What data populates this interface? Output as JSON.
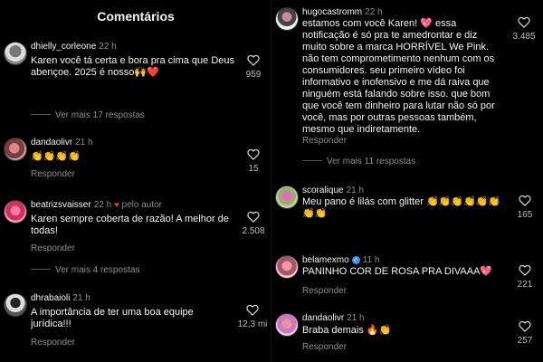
{
  "header": {
    "title": "Comentários"
  },
  "left": {
    "comments": [
      {
        "user": "dhielly_corleone",
        "time": "22 h",
        "text": "Karen você tá certa e bora pra cima que Deus abençoe.  2025 é nosso🙌❤️",
        "reply_label": "",
        "likes": "959",
        "more_replies": "Ver mais 17 respostas"
      },
      {
        "user": "dandaolivr",
        "time": "21 h",
        "text": "👏👏👏👏",
        "reply_label": "Responder",
        "likes": "15"
      },
      {
        "user": "beatrizsvaisser",
        "time": "22 h",
        "by_author": "pelo autor",
        "text": "Karen sempre coberta de razão! A melhor de todas!",
        "reply_label": "Responder",
        "likes": "2.508",
        "more_replies": "Ver mais 4 respostas"
      },
      {
        "user": "dhrabaioli",
        "time": "21 h",
        "text": "A importância de ter uma boa equipe jurídica!!!",
        "reply_label": "Responder",
        "likes": "12,3 mi"
      }
    ]
  },
  "right": {
    "comments": [
      {
        "user": "hugocastromm",
        "time": "22 h",
        "text": "estamos com você Karen! 💖 essa notificação é só pra te amedrontar e diz muito sobre a marca HORRÍVEL We Pink. não tem comprometimento nenhum com os consumidores. seu primeiro vídeo foi informativo e inofensivo e me dá raiva que ninguém está falando sobre isso. que bom que você tem dinheiro para lutar não só por você, mas por outras pessoas também, mesmo que indiretamente.",
        "reply_label": "Responder",
        "likes": "3.485",
        "more_replies": "Ver mais 11 respostas"
      },
      {
        "user": "scoralique",
        "time": "21 h",
        "text": "Meu pano é lilás com glitter 👏👏👏👏👏👏👏👏",
        "reply_label": "Responder",
        "likes": "165"
      },
      {
        "user": "belamexmo",
        "time": "11 h",
        "text": "PANINHO COR DE ROSA PRA DIVAAA💖",
        "reply_label": "Responder",
        "likes": "221"
      },
      {
        "user": "dandaolivr",
        "time": "21 h",
        "text": "Braba demais 🔥👏",
        "reply_label": "Responder",
        "likes": "257"
      }
    ]
  },
  "colors": {
    "background": "#000000",
    "text": "#f5f5f5",
    "muted": "#8e8e8e",
    "heart_red": "#ff3040",
    "verified_blue": "#3897f0"
  },
  "icons": [
    "heart-outline-icon",
    "heart-filled-icon",
    "verified-badge-icon"
  ]
}
